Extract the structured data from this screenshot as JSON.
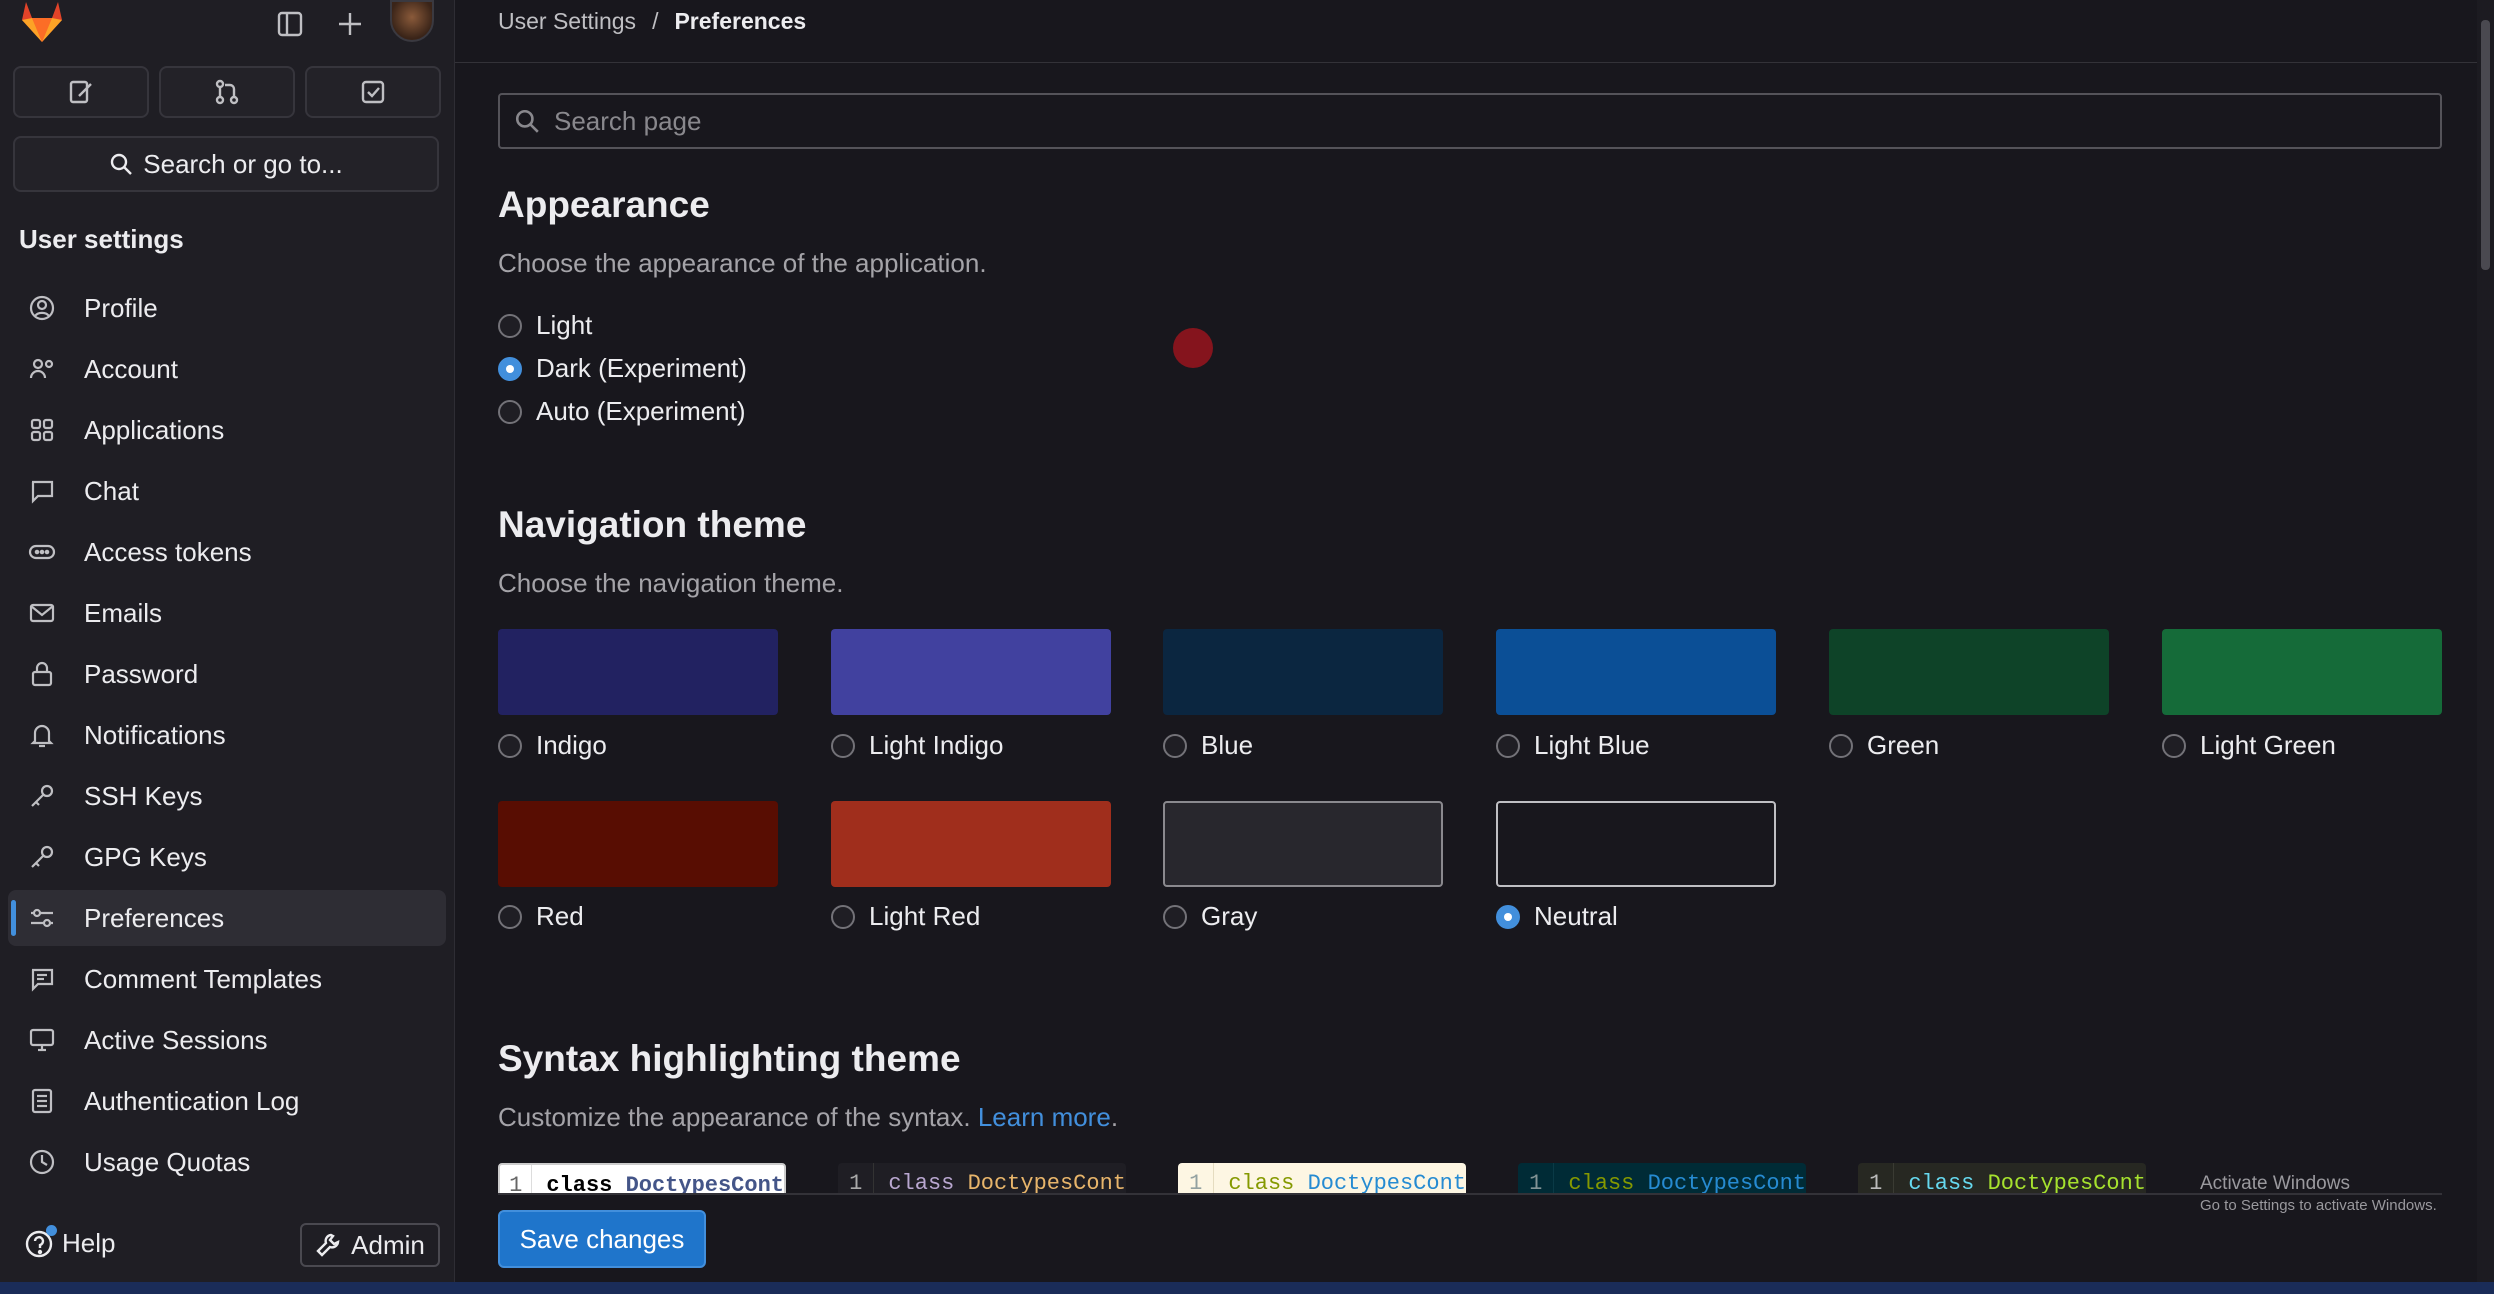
{
  "sidebar": {
    "title": "User settings",
    "search_label": "Search or go to...",
    "items": [
      {
        "label": "Profile",
        "icon": "profile-icon"
      },
      {
        "label": "Account",
        "icon": "account-icon"
      },
      {
        "label": "Applications",
        "icon": "applications-icon"
      },
      {
        "label": "Chat",
        "icon": "chat-icon"
      },
      {
        "label": "Access tokens",
        "icon": "token-icon"
      },
      {
        "label": "Emails",
        "icon": "mail-icon"
      },
      {
        "label": "Password",
        "icon": "lock-icon"
      },
      {
        "label": "Notifications",
        "icon": "bell-icon"
      },
      {
        "label": "SSH Keys",
        "icon": "key-icon"
      },
      {
        "label": "GPG Keys",
        "icon": "key-icon"
      },
      {
        "label": "Preferences",
        "icon": "preferences-icon",
        "active": true
      },
      {
        "label": "Comment Templates",
        "icon": "comment-icon"
      },
      {
        "label": "Active Sessions",
        "icon": "monitor-icon"
      },
      {
        "label": "Authentication Log",
        "icon": "log-icon"
      },
      {
        "label": "Usage Quotas",
        "icon": "quota-icon"
      }
    ],
    "help_label": "Help",
    "admin_label": "Admin"
  },
  "breadcrumb": {
    "parent": "User Settings",
    "separator": "/",
    "current": "Preferences"
  },
  "search": {
    "placeholder": "Search page"
  },
  "appearance": {
    "title": "Appearance",
    "description": "Choose the appearance of the application.",
    "options": [
      "Light",
      "Dark (Experiment)",
      "Auto (Experiment)"
    ],
    "selected": "Dark (Experiment)"
  },
  "navigation_theme": {
    "title": "Navigation theme",
    "description": "Choose the navigation theme.",
    "themes": [
      {
        "label": "Indigo",
        "color": "#222261"
      },
      {
        "label": "Light Indigo",
        "color": "#41419f"
      },
      {
        "label": "Blue",
        "color": "#0b2640"
      },
      {
        "label": "Light Blue",
        "color": "#0b4f96"
      },
      {
        "label": "Green",
        "color": "#0e4328"
      },
      {
        "label": "Light Green",
        "color": "#156b39"
      },
      {
        "label": "Red",
        "color": "#580d02"
      },
      {
        "label": "Light Red",
        "color": "#a02e1c"
      },
      {
        "label": "Gray",
        "color": "#28272d"
      },
      {
        "label": "Neutral",
        "color": "#18171d"
      }
    ],
    "selected": "Neutral"
  },
  "syntax": {
    "title": "Syntax highlighting theme",
    "description": "Customize the appearance of the syntax.",
    "learn_more": "Learn more",
    "period": ".",
    "line_number": "1",
    "code_keyword": "class",
    "code_name": "DoctypesCont"
  },
  "watermark": {
    "title": "Activate Windows",
    "subtitle": "Go to Settings to activate Windows."
  },
  "save_label": "Save changes",
  "colors": {
    "accent": "#428fdc",
    "primary_button": "#1f75cb",
    "background": "#18171d",
    "sidebar": "#1f1e24"
  }
}
